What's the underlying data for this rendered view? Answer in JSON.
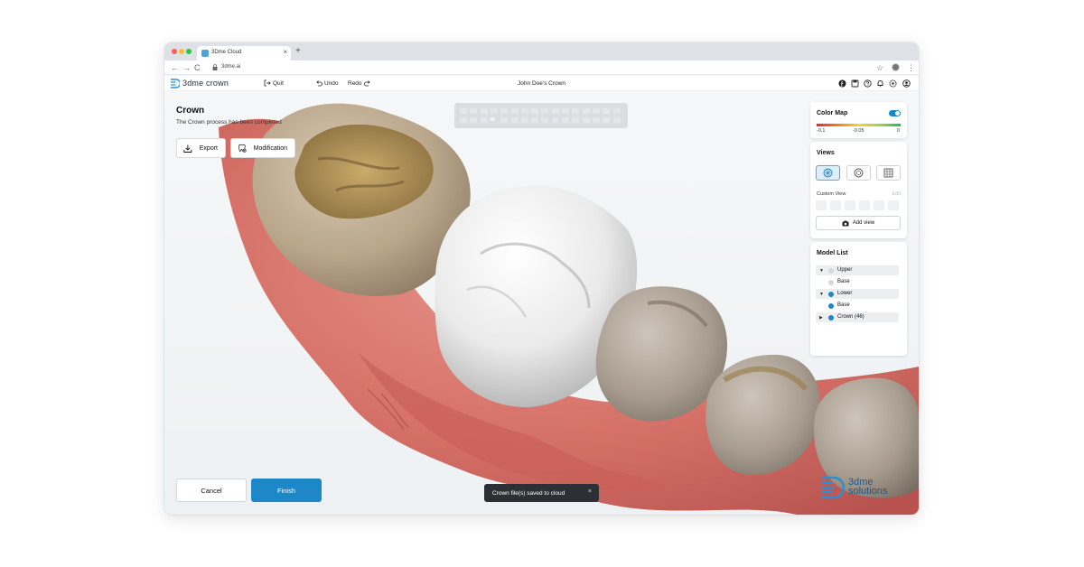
{
  "browser": {
    "tab_title": "3Dme Cloud",
    "tab_close": "×",
    "new_tab": "+",
    "url": "3dme.ai",
    "nav_back": "←",
    "nav_forward": "→",
    "nav_reload": "C",
    "star": "☆",
    "menu": "⋮"
  },
  "header": {
    "logo_text": "3dme crown",
    "quit_label": "Quit",
    "undo_label": "Undo",
    "redo_label": "Redo",
    "case_title": "John Doe's Crown"
  },
  "panel": {
    "title": "Crown",
    "subtitle": "The Crown process has been completed",
    "export_label": "Export",
    "modification_label": "Modification"
  },
  "tooth_selector": {
    "active_tooth": "46"
  },
  "color_map": {
    "title": "Color Map",
    "enabled": true,
    "min_label": "-0.1",
    "mid_label": "-0.05",
    "max_label": "0",
    "gradient_colors": [
      "#e32b2b",
      "#f47b20",
      "#f5d432",
      "#a3d04a",
      "#2bb36b"
    ]
  },
  "views": {
    "title": "Views",
    "custom_view_label": "Custom View",
    "edit_label": "Edit",
    "add_view_label": "Add view",
    "view_buttons": [
      "occlusal-view-icon",
      "side-view-icon",
      "grid-view-icon"
    ]
  },
  "model_list": {
    "title": "Model List",
    "items": [
      {
        "label": "Upper",
        "arrow": "▼",
        "group": true,
        "visible": false
      },
      {
        "label": "Base",
        "arrow": "",
        "group": false,
        "visible": false
      },
      {
        "label": "Lower",
        "arrow": "▼",
        "group": true,
        "visible": true
      },
      {
        "label": "Base",
        "arrow": "",
        "group": false,
        "visible": true
      },
      {
        "label": "Crown (46)",
        "arrow": "▶",
        "group": true,
        "visible": true
      }
    ]
  },
  "footer": {
    "cancel_label": "Cancel",
    "finish_label": "Finish",
    "toast_text": "Crown file(s) saved to cloud",
    "toast_close": "×"
  },
  "brand": {
    "line1": "3dme",
    "line2": "solutions"
  },
  "colors": {
    "accent": "#1e87c8",
    "toast_bg": "#2c2f33",
    "gum": "#d9756a"
  }
}
